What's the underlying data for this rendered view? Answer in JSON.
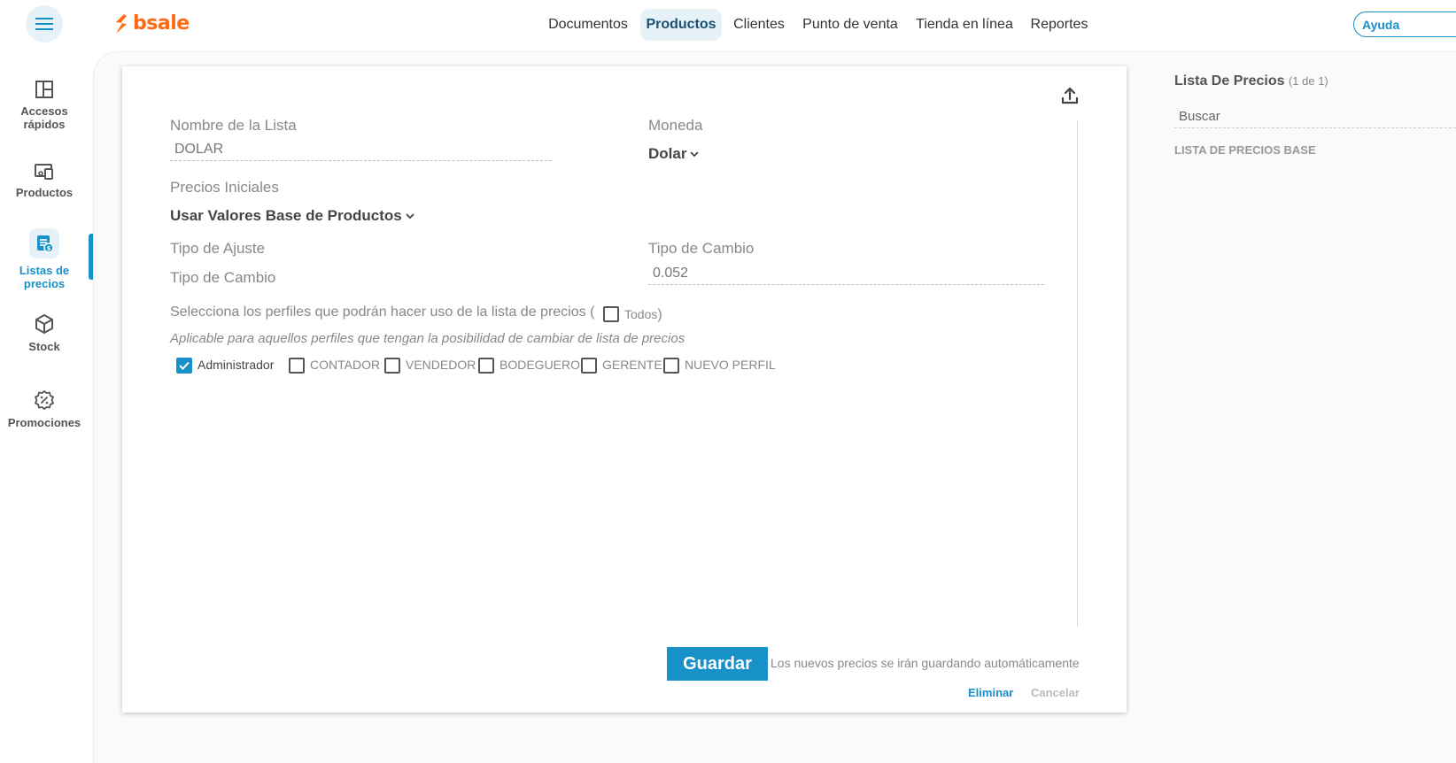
{
  "header": {
    "logo_text": "bsale",
    "nav": [
      {
        "label": "Documentos"
      },
      {
        "label": "Productos"
      },
      {
        "label": "Clientes"
      },
      {
        "label": "Punto de venta"
      },
      {
        "label": "Tienda en línea"
      },
      {
        "label": "Reportes"
      }
    ],
    "active_nav": "Productos",
    "help_label": "Ayuda"
  },
  "sidebar": {
    "items": [
      {
        "label": "Accesos rápidos",
        "icon": "layout-icon"
      },
      {
        "label": "Productos",
        "icon": "devices-icon"
      },
      {
        "label": "Listas de precios",
        "icon": "price-list-icon"
      },
      {
        "label": "Stock",
        "icon": "box-icon"
      },
      {
        "label": "Promociones",
        "icon": "percent-badge-icon"
      }
    ],
    "active": "Listas de precios"
  },
  "form": {
    "list_name_label": "Nombre de la Lista",
    "list_name_value": "DOLAR",
    "currency_label": "Moneda",
    "currency_value": "Dolar",
    "initial_prices_label": "Precios Iniciales",
    "initial_prices_value": "Usar Valores Base de Productos",
    "adjust_type_label": "Tipo de Ajuste",
    "exchange_type_label": "Tipo de Cambio",
    "exchange_type_label_right": "Tipo de Cambio",
    "exchange_rate_value": "0.052",
    "profiles_prompt_pre": "Selecciona los perfiles que podrán hacer uso de la lista de precios (",
    "all_label": "Todos",
    "profiles_prompt_post": ")",
    "profiles_note": "Aplicable para aquellos perfiles que tengan la posibilidad de cambiar de lista de precios",
    "profiles": [
      {
        "label": "Administrador",
        "checked": true
      },
      {
        "label": "CONTADOR",
        "checked": false
      },
      {
        "label": "VENDEDOR",
        "checked": false
      },
      {
        "label": "BODEGUERO",
        "checked": false
      },
      {
        "label": "GERENTE",
        "checked": false
      },
      {
        "label": "NUEVO PERFIL",
        "checked": false
      }
    ],
    "save_label": "Guardar",
    "save_note": "Los nuevos precios se irán guardando automáticamente",
    "delete_label": "Eliminar",
    "cancel_label": "Cancelar"
  },
  "right_panel": {
    "title": "Lista De Precios",
    "count": "(1 de 1)",
    "search_placeholder": "Buscar",
    "items": [
      {
        "label": "LISTA DE PRECIOS BASE"
      }
    ]
  },
  "colors": {
    "accent": "#1890c8",
    "brand": "#ff6a13",
    "active_bg": "#e6f2f8"
  }
}
